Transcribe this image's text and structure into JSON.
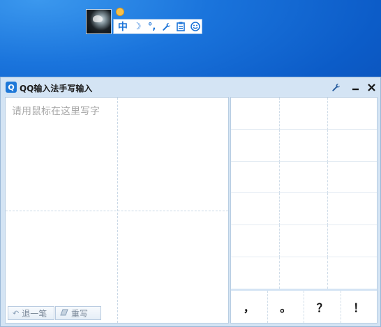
{
  "ime_bar": {
    "mode_label": "中",
    "buttons": [
      {
        "icon": "moon-icon",
        "glyph": "☽"
      },
      {
        "icon": "punctuation-icon",
        "glyph": "°,"
      },
      {
        "icon": "wrench-icon",
        "glyph": "🔧"
      },
      {
        "icon": "clipboard-icon",
        "glyph": "📋"
      },
      {
        "icon": "smiley-icon",
        "glyph": "☺"
      }
    ]
  },
  "window": {
    "logo": "Q",
    "title": "QQ输入法手写输入",
    "settings_glyph": "🔧",
    "minimize_glyph": "—",
    "close_glyph": "✕"
  },
  "pad": {
    "placeholder": "请用鼠标在这里写字",
    "undo_label": "退一笔",
    "undo_icon": "↶",
    "rewrite_label": "重写",
    "rewrite_icon": "◢"
  },
  "candidates": {
    "punctuation": [
      "，",
      "。",
      "？",
      "！"
    ]
  },
  "colors": {
    "accent": "#1c74d8",
    "window_bg": "#d4e4f4"
  }
}
